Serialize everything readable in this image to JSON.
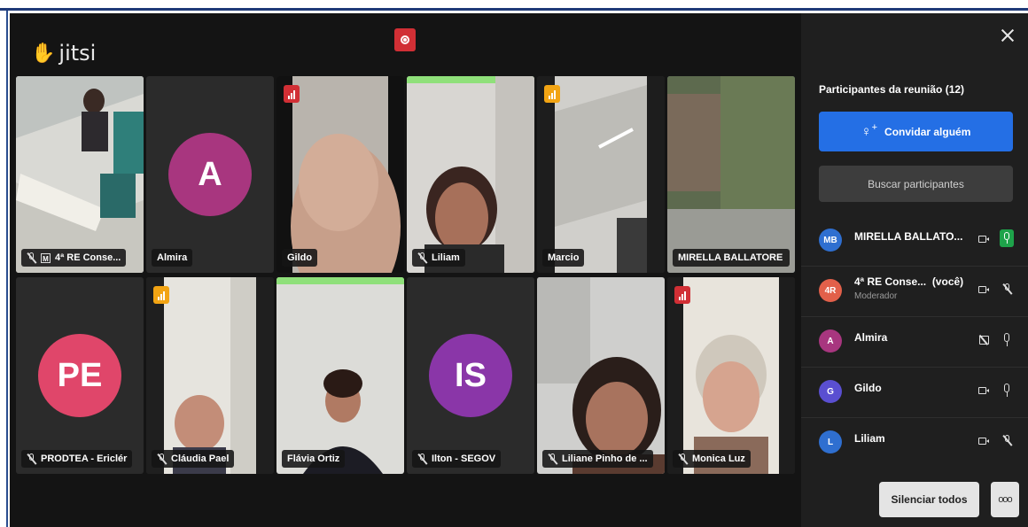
{
  "app": {
    "logo_text": "jitsi"
  },
  "tiles": [
    {
      "name": "4ª RE Conse...",
      "muted": true,
      "mod_badge": "M",
      "type": "video"
    },
    {
      "name": "Almira",
      "type": "avatar",
      "initials": "A",
      "color": "#a8367f"
    },
    {
      "name": "Gildo",
      "type": "video",
      "conn": "red"
    },
    {
      "name": "Liliam",
      "muted": true,
      "type": "video"
    },
    {
      "name": "Marcio",
      "type": "video",
      "conn": "yellow"
    },
    {
      "name": "MIRELLA BALLATORE",
      "type": "video",
      "selected": true
    },
    {
      "name": "PRODTEA - Ericlér",
      "muted": true,
      "type": "avatar",
      "initials": "PE",
      "color": "#e0466a"
    },
    {
      "name": "Cláudia Pael",
      "muted": true,
      "type": "video",
      "conn": "yellow"
    },
    {
      "name": "Flávia Ortiz",
      "type": "video"
    },
    {
      "name": "Ilton - SEGOV",
      "muted": true,
      "type": "avatar",
      "initials": "IS",
      "color": "#8a36a8"
    },
    {
      "name": "Liliane Pinho de ...",
      "muted": true,
      "type": "video"
    },
    {
      "name": "Monica Luz",
      "muted": true,
      "type": "video",
      "conn": "red"
    }
  ],
  "panel": {
    "title": "Participantes da reunião (12)",
    "invite_label": "Convidar alguém",
    "invite_icon": "person-plus-icon",
    "search_placeholder": "Buscar participantes",
    "participants": [
      {
        "initials": "MB",
        "name": "MIRELLA BALLATO...",
        "color": "#2f6fd0",
        "mic": "active"
      },
      {
        "initials": "4R",
        "name": "4ª RE Conse...",
        "suffix": "(você)",
        "role": "Moderador",
        "color": "#e2604a",
        "mic": "off"
      },
      {
        "initials": "A",
        "name": "Almira",
        "color": "#a8367f",
        "mic": "on",
        "cam": "off"
      },
      {
        "initials": "G",
        "name": "Gildo",
        "color": "#5a4fd1",
        "mic": "on"
      },
      {
        "initials": "L",
        "name": "Liliam",
        "color": "#2f6fd0",
        "mic": "off"
      }
    ],
    "mute_all_label": "Silenciar todos",
    "more_label": "ooo"
  },
  "colors": {
    "accent": "#246fe5",
    "record": "#d12f35",
    "conn_red": "#d12f35",
    "conn_yellow": "#f2a413"
  }
}
